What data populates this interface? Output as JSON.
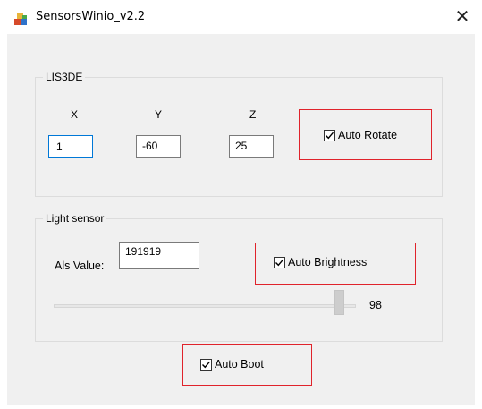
{
  "window": {
    "title": "SensorsWinio_v2.2",
    "close_glyph": "✕",
    "app_icon": "sensors-app-icon"
  },
  "lis3de": {
    "group_label": "LIS3DE",
    "axis_labels": {
      "x": "X",
      "y": "Y",
      "z": "Z"
    },
    "values": {
      "x": "1",
      "y": "-60",
      "z": "25"
    },
    "auto_rotate": {
      "label": "Auto Rotate",
      "checked": true
    }
  },
  "light_sensor": {
    "group_label": "Light sensor",
    "als_label": "Als Value:",
    "als_value": "191919",
    "auto_brightness": {
      "label": "Auto Brightness",
      "checked": true
    },
    "brightness_value": "98",
    "brightness_level": 0.98
  },
  "auto_boot": {
    "label": "Auto Boot",
    "checked": true
  },
  "colors": {
    "highlight": "#e0232b",
    "focus_border": "#0078d7",
    "client_bg": "#f0f0f0"
  }
}
